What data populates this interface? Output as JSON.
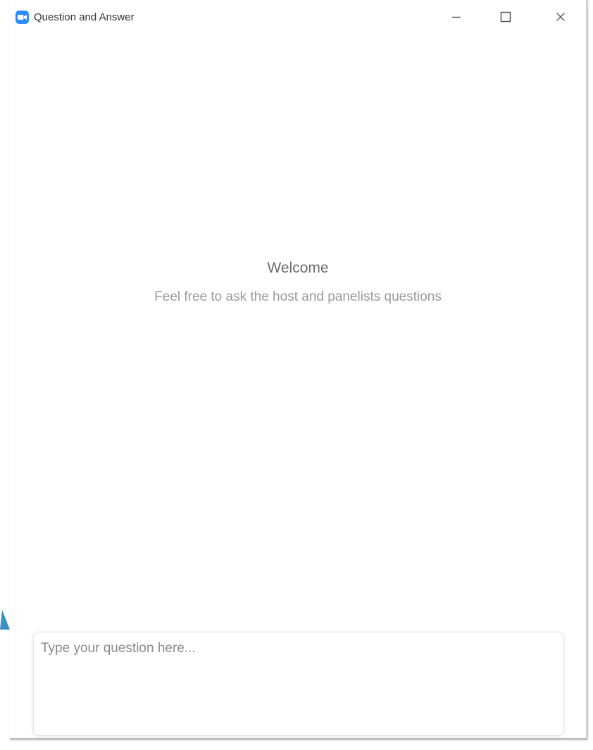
{
  "window": {
    "title": "Question and Answer",
    "controls": [
      "minimize-icon",
      "maximize-icon",
      "close-icon"
    ],
    "app_icon": "zoom-camera-icon"
  },
  "main": {
    "welcome_title": "Welcome",
    "welcome_subtitle": "Feel free to ask the host and panelists questions"
  },
  "question": {
    "placeholder": "Type your question here...",
    "value": ""
  },
  "colors": {
    "brand": "#2d8cff",
    "annotation_arrow": "#3a8fc8"
  }
}
